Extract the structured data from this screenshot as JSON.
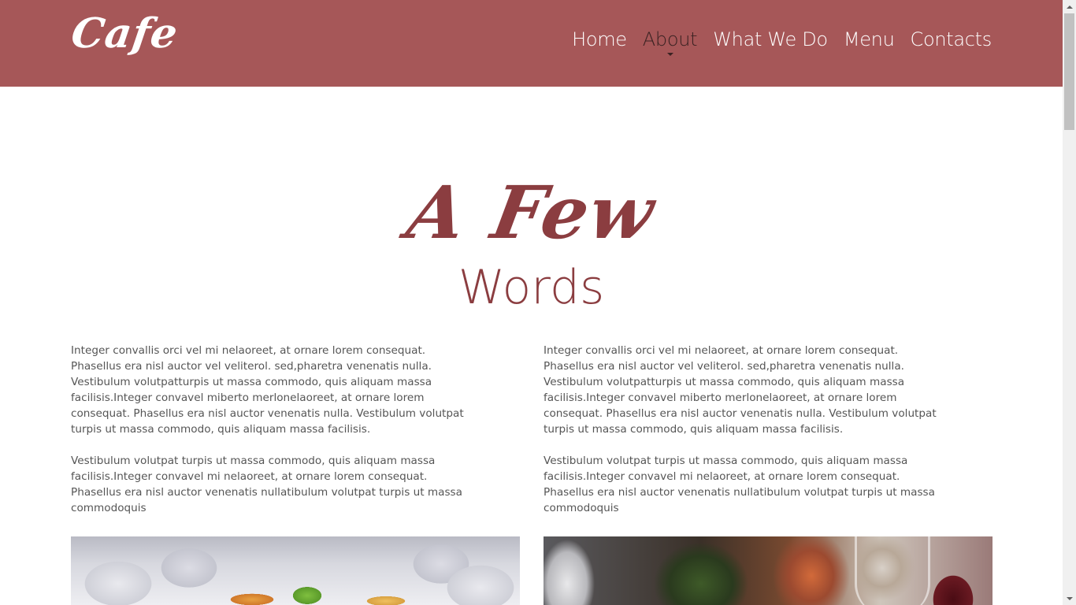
{
  "header": {
    "logo": "Cafe",
    "background_color": "#a65758",
    "nav": [
      {
        "label": "Home"
      },
      {
        "label": "About",
        "active": true
      },
      {
        "label": "What We Do"
      },
      {
        "label": "Menu"
      },
      {
        "label": "Contacts"
      }
    ]
  },
  "section": {
    "heading_script": "A Few",
    "heading_sub": "Words",
    "accent_color": "#8b3d40",
    "columns": [
      {
        "paragraphs": [
          "Integer convallis orci vel mi nelaoreet, at ornare lorem consequat. Phasellus era nisl auctor vel veliterol. sed,pharetra venenatis nulla. Vestibulum volutpatturpis ut massa commodo, quis aliquam massa facilisis.Integer convavel miberto merlonelaoreet, at ornare lorem consequat. Phasellus era nisl auctor venenatis nulla. Vestibulum volutpat turpis ut massa commodo, quis aliquam massa facilisis.",
          "Vestibulum volutpat turpis ut massa commodo, quis aliquam massa facilisis.Integer convavel mi nelaoreet, at ornare lorem consequat. Phasellus era nisl auctor venenatis nullatibulum volutpat turpis ut massa commodoquis"
        ]
      },
      {
        "paragraphs": [
          "Integer convallis orci vel mi nelaoreet, at ornare lorem consequat. Phasellus era nisl auctor vel veliterol. sed,pharetra venenatis nulla. Vestibulum volutpatturpis ut massa commodo, quis aliquam massa facilisis.Integer convavel miberto merlonelaoreet, at ornare lorem consequat. Phasellus era nisl auctor venenatis nulla. Vestibulum volutpat turpis ut massa commodo, quis aliquam massa facilisis.",
          "Vestibulum volutpat turpis ut massa commodo, quis aliquam massa facilisis.Integer convavel mi nelaoreet, at ornare lorem consequat. Phasellus era nisl auctor venenatis nullatibulum volutpat turpis ut massa commodoquis"
        ]
      }
    ]
  },
  "icons": {
    "caret": "caret-down-icon",
    "scroll_up": "arrow-up-icon",
    "scroll_down": "arrow-down-icon"
  }
}
